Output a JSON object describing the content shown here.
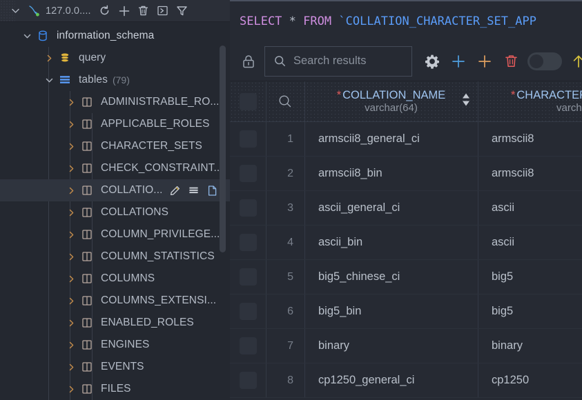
{
  "connection": {
    "name": "127.0.0....",
    "status_color": "#62c554",
    "toolbar": [
      {
        "icon": "chevron-down-icon",
        "name": "collapse-toggle"
      },
      {
        "icon": "mysql-dolphin-icon",
        "name": "datasource-icon"
      },
      {
        "icon": "refresh-icon",
        "name": "refresh-button"
      },
      {
        "icon": "plus-icon",
        "name": "add-button"
      },
      {
        "icon": "trash-icon",
        "name": "delete-button"
      },
      {
        "icon": "console-icon",
        "name": "open-console-button"
      },
      {
        "icon": "filter-icon",
        "name": "filter-button"
      }
    ]
  },
  "tree": [
    {
      "label": "information_schema",
      "icon": "database-icon",
      "expanded": true,
      "depth": 0,
      "count": null,
      "selected": false
    },
    {
      "label": "query",
      "icon": "query-stack-icon",
      "expanded": false,
      "depth": 1,
      "count": null,
      "selected": false
    },
    {
      "label": "tables",
      "icon": "tables-icon",
      "expanded": true,
      "depth": 1,
      "count": "(79)",
      "selected": false
    },
    {
      "label": "ADMINISTRABLE_RO...",
      "icon": "table-icon",
      "expanded": false,
      "depth": 2,
      "count": null,
      "selected": false
    },
    {
      "label": "APPLICABLE_ROLES",
      "icon": "table-icon",
      "expanded": false,
      "depth": 2,
      "count": null,
      "selected": false
    },
    {
      "label": "CHARACTER_SETS",
      "icon": "table-icon",
      "expanded": false,
      "depth": 2,
      "count": null,
      "selected": false
    },
    {
      "label": "CHECK_CONSTRAINT...",
      "icon": "table-icon",
      "expanded": false,
      "depth": 2,
      "count": null,
      "selected": false
    },
    {
      "label": "COLLATIO...",
      "icon": "table-icon",
      "expanded": false,
      "depth": 2,
      "count": null,
      "selected": true
    },
    {
      "label": "COLLATIONS",
      "icon": "table-icon",
      "expanded": false,
      "depth": 2,
      "count": null,
      "selected": false
    },
    {
      "label": "COLUMN_PRIVILEGE...",
      "icon": "table-icon",
      "expanded": false,
      "depth": 2,
      "count": null,
      "selected": false
    },
    {
      "label": "COLUMN_STATISTICS",
      "icon": "table-icon",
      "expanded": false,
      "depth": 2,
      "count": null,
      "selected": false
    },
    {
      "label": "COLUMNS",
      "icon": "table-icon",
      "expanded": false,
      "depth": 2,
      "count": null,
      "selected": false
    },
    {
      "label": "COLUMNS_EXTENSI...",
      "icon": "table-icon",
      "expanded": false,
      "depth": 2,
      "count": null,
      "selected": false
    },
    {
      "label": "ENABLED_ROLES",
      "icon": "table-icon",
      "expanded": false,
      "depth": 2,
      "count": null,
      "selected": false
    },
    {
      "label": "ENGINES",
      "icon": "table-icon",
      "expanded": false,
      "depth": 2,
      "count": null,
      "selected": false
    },
    {
      "label": "EVENTS",
      "icon": "table-icon",
      "expanded": false,
      "depth": 2,
      "count": null,
      "selected": false
    },
    {
      "label": "FILES",
      "icon": "table-icon",
      "expanded": false,
      "depth": 2,
      "count": null,
      "selected": false
    }
  ],
  "selected_row_actions": [
    {
      "icon": "pencil-icon",
      "name": "rename-table-action"
    },
    {
      "icon": "table-data-icon",
      "name": "view-data-action"
    },
    {
      "icon": "file-icon",
      "name": "ddl-action"
    }
  ],
  "editor": {
    "tokens": [
      {
        "text": "SELECT",
        "type": "kw"
      },
      {
        "text": " ",
        "type": "plain"
      },
      {
        "text": "*",
        "type": "star"
      },
      {
        "text": " ",
        "type": "plain"
      },
      {
        "text": "FROM",
        "type": "kw"
      },
      {
        "text": " ",
        "type": "plain"
      },
      {
        "text": "`COLLATION_CHARACTER_SET_APP",
        "type": "ident"
      }
    ],
    "full_text": "SELECT * FROM `COLLATION_CHARACTER_SET_APP"
  },
  "results_toolbar": {
    "lock_icon": "lock-icon",
    "search": {
      "placeholder": "Search results",
      "value": "",
      "icon": "search-icon"
    },
    "buttons": [
      {
        "icon": "gear-icon",
        "name": "settings-button",
        "color": "#c4c9d1"
      },
      {
        "icon": "plus-icon-blue",
        "name": "add-row-button",
        "color": "#4f9fe0"
      },
      {
        "icon": "plus-icon-orange",
        "name": "add-column-button",
        "color": "#e0a060"
      },
      {
        "icon": "trash-icon",
        "name": "delete-row-button",
        "color": "#e05a5a"
      },
      {
        "icon": "toggle-switch",
        "name": "transaction-toggle",
        "color": "#3a4049"
      },
      {
        "icon": "arrow-up-icon",
        "name": "submit-button",
        "color": "#d8c33c"
      },
      {
        "icon": "arrow-down-icon",
        "name": "revert-button",
        "color": "#4f7fe0"
      }
    ]
  },
  "grid": {
    "columns": [
      {
        "name": "COLLATION_NAME",
        "type": "varchar(64)",
        "required": true,
        "sortable": true
      },
      {
        "name": "CHARACTER",
        "type": "varcha",
        "required": true,
        "sortable": false
      }
    ],
    "rows": [
      {
        "n": "1",
        "collation_name": "armscii8_general_ci",
        "character_set_name": "armscii8"
      },
      {
        "n": "2",
        "collation_name": "armscii8_bin",
        "character_set_name": "armscii8"
      },
      {
        "n": "3",
        "collation_name": "ascii_general_ci",
        "character_set_name": "ascii"
      },
      {
        "n": "4",
        "collation_name": "ascii_bin",
        "character_set_name": "ascii"
      },
      {
        "n": "5",
        "collation_name": "big5_chinese_ci",
        "character_set_name": "big5"
      },
      {
        "n": "6",
        "collation_name": "big5_bin",
        "character_set_name": "big5"
      },
      {
        "n": "7",
        "collation_name": "binary",
        "character_set_name": "binary"
      },
      {
        "n": "8",
        "collation_name": "cp1250_general_ci",
        "character_set_name": "cp1250"
      }
    ]
  },
  "theme": {
    "bg_dark": "#1e2128",
    "panel_bg": "#242830",
    "grid_bg": "#262a33",
    "accent_blue": "#5a9cf8",
    "keyword_purple": "#cf8ee0",
    "required_red": "#e05a5a",
    "selection": "#2f343e"
  }
}
